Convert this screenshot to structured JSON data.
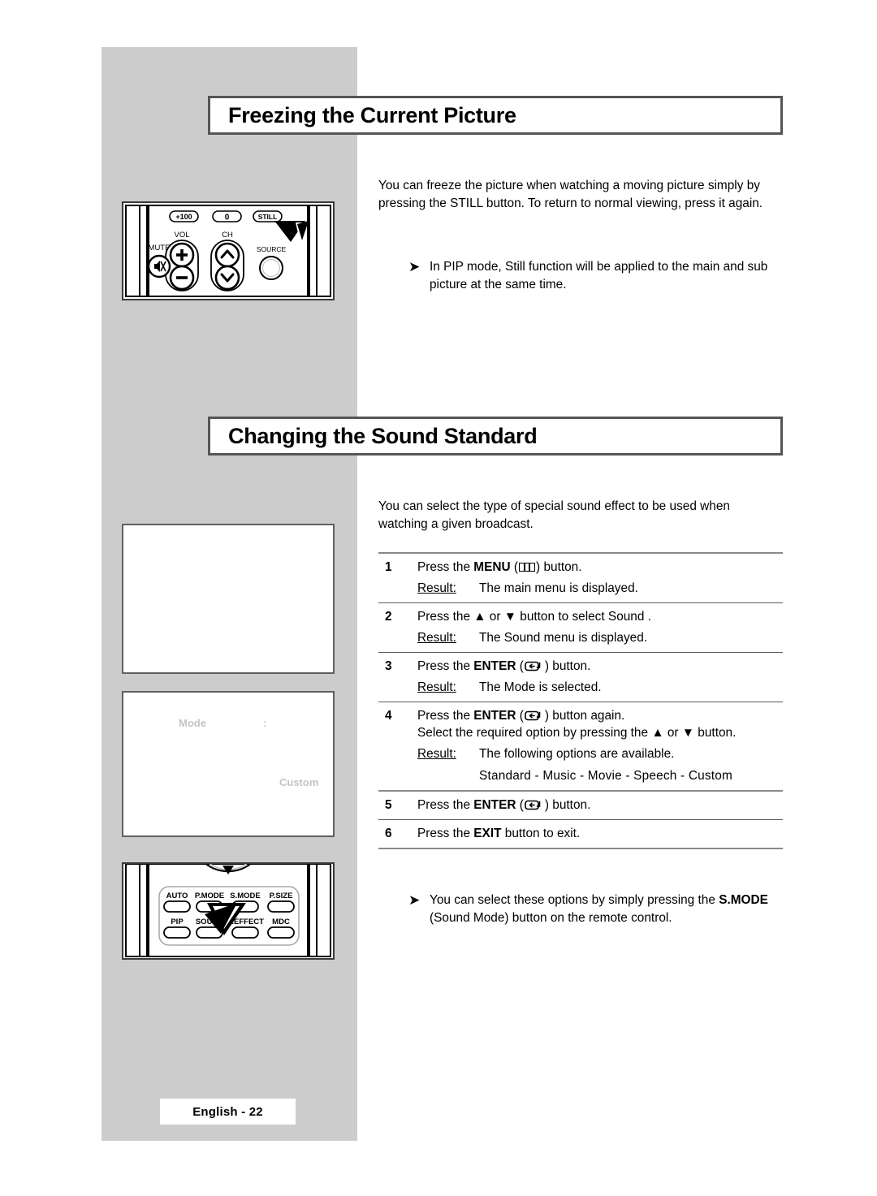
{
  "document": {
    "footer_page_label": "English - 22"
  },
  "sections": [
    {
      "heading": "Freezing the Current Picture",
      "intro": "You can freeze the picture when watching a moving picture simply by pressing the  STILL  button. To return to normal viewing, press it again.",
      "note": "In PIP mode, Still function will be applied to the main and sub picture at the same time.",
      "bullet_glyph": "➤"
    },
    {
      "heading": "Changing the Sound Standard",
      "intro": "You can select the type of special sound effect to be used when watching a given broadcast.",
      "note_prefix": "You can select these options by simply pressing the ",
      "note_bold": "S.MODE",
      "note_suffix": " (Sound Mode) button on the remote control.",
      "bullet_glyph": "➤"
    }
  ],
  "steps": [
    {
      "num": "1",
      "text_before": "Press the ",
      "bold": "MENU",
      "icon": "menu-icon",
      "text_after": " button.",
      "result_label": "Result:",
      "result_text": "The main menu is displayed."
    },
    {
      "num": "2",
      "line": "Press the ▲ or ▼ button to select Sound .",
      "result_label": "Result:",
      "result_text": "The Sound menu is displayed."
    },
    {
      "num": "3",
      "text_before": "Press the ",
      "bold": "ENTER",
      "icon": "enter-icon",
      "text_after": " button.",
      "result_label": "Result:",
      "result_text": "The Mode is selected."
    },
    {
      "num": "4",
      "text_before": "Press the ",
      "bold": "ENTER",
      "icon": "enter-icon",
      "text_after": " button again.",
      "line2": "Select the required option by pressing the ▲ or ▼ button.",
      "result_label": "Result:",
      "result_text": "The following options are available.",
      "options": "Standard   - Music  - Movie  - Speech  - Custom"
    },
    {
      "num": "5",
      "text_before": "Press the ",
      "bold": "ENTER",
      "icon": "enter-icon",
      "text_after": " button.",
      "result_label": "",
      "result_text": ""
    },
    {
      "num": "6",
      "text_before": "Press the ",
      "bold": "EXIT",
      "text_after": " button to exit.",
      "result_label": "",
      "result_text": ""
    }
  ],
  "osd_screens": [
    {
      "labels": []
    },
    {
      "mode": "Mode",
      "colon": ":",
      "value": "Custom"
    }
  ],
  "remote_top": {
    "buttons": [
      "+100",
      "0",
      "STILL"
    ],
    "labels": {
      "vol": "VOL",
      "ch": "CH",
      "mute": "MUTE",
      "source": "SOURCE"
    },
    "highlight": "STILL"
  },
  "remote_bottom": {
    "row1": [
      "AUTO",
      "P.MODE",
      "S.MODE",
      "P.SIZE"
    ],
    "row2": [
      "PIP",
      "SOUND",
      "S.EFFECT",
      "MDC"
    ],
    "highlight": "S.MODE"
  },
  "colors": {
    "panel_gray": "#cccccc",
    "heading_border": "#555555",
    "rule_gray": "#8a8a8a",
    "osd_text": "#c4c4c4"
  }
}
